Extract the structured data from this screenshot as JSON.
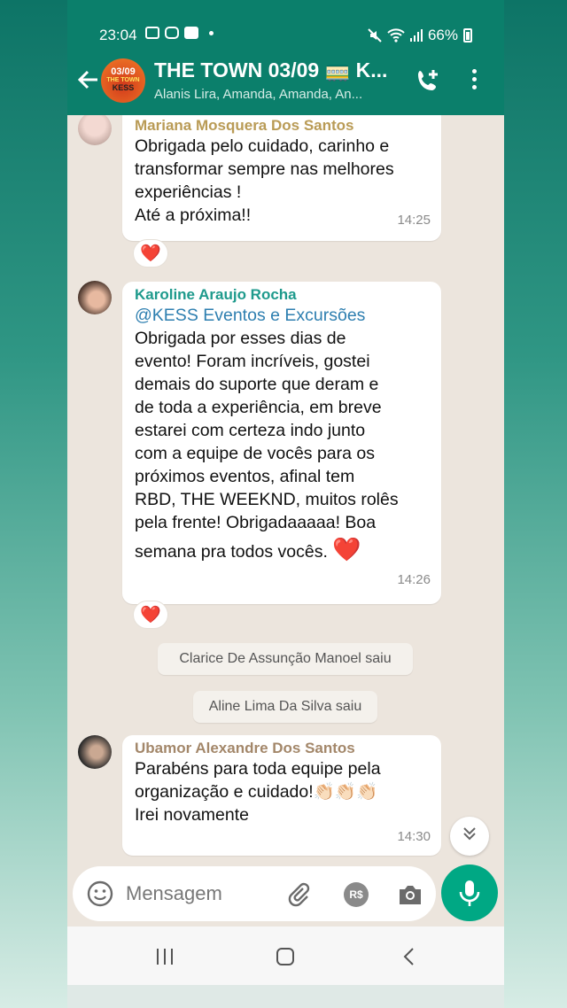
{
  "status_bar": {
    "time": "23:04",
    "battery": "66%",
    "icons": [
      "gallery-icon",
      "instagram-icon",
      "youtube-icon",
      "mute-icon",
      "wifi-icon",
      "signal-icon",
      "battery-icon"
    ]
  },
  "header": {
    "avatar_lines": [
      "03/09",
      "THE TOWN",
      "KESS"
    ],
    "title": "THE TOWN 03/09 🚃 K...",
    "subtitle": "Alanis Lira, Amanda, Amanda, An..."
  },
  "messages": [
    {
      "sender": "Mariana Mosquera Dos Santos",
      "sender_color": "#b99b56",
      "lines": [
        "Obrigada pelo cuidado, carinho e",
        "transformar sempre nas melhores",
        "experiências !",
        "Até a próxima!!"
      ],
      "time": "14:25",
      "reaction": "❤️"
    },
    {
      "sender": "Karoline Araujo Rocha",
      "sender_color": "#1e9a8c",
      "mention": "@KESS Eventos e Excursões",
      "lines": [
        "Obrigada por esses dias de",
        "evento! Foram incríveis, gostei",
        "demais do suporte que deram e",
        "de toda a experiência, em breve",
        "estarei com certeza indo junto",
        "com a equipe de vocês para os",
        "próximos eventos, afinal tem",
        "RBD, THE WEEKND, muitos rolês",
        "pela frente! Obrigadaaaaa! Boa",
        "semana pra todos vocês."
      ],
      "emoji_end": "❤️",
      "time": "14:26",
      "reaction": "❤️"
    },
    {
      "sender": "Ubamor Alexandre Dos Santos",
      "sender_color": "#a3876a",
      "lines": [
        "Parabéns para toda equipe pela",
        "organização e cuidado!👏🏻👏🏻👏🏻",
        "Irei novamente"
      ],
      "time": "14:30"
    }
  ],
  "system_messages": [
    "Clarice De Assunção Manoel saiu",
    "Aline Lima Da Silva saiu"
  ],
  "composer": {
    "placeholder": "Mensagem",
    "pix_label": "R$"
  }
}
